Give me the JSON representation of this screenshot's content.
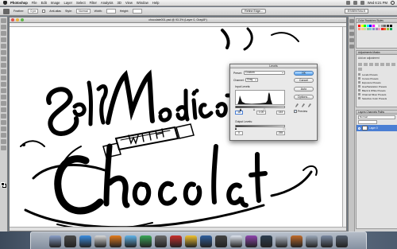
{
  "menubar": {
    "items": [
      "Photoshop",
      "File",
      "Edit",
      "Image",
      "Layer",
      "Select",
      "Filter",
      "Analysis",
      "3D",
      "View",
      "Window",
      "Help"
    ],
    "clock": "Wed 6:21 PM"
  },
  "options": {
    "feather_label": "Feather:",
    "feather_value": "0 px",
    "antialias_label": "Anti-alias",
    "style_label": "Style:",
    "style_value": "Normal",
    "width_label": "Width:",
    "height_label": "Height:",
    "refine_label": "Refine Edge...",
    "workspace_label": "ESSENTIALS"
  },
  "document": {
    "title": "chocolate001.psd @ 93.3% (Layer 0, Gray/8*)"
  },
  "levels_dialog": {
    "title": "Levels",
    "preset_label": "Preset:",
    "preset_value": "Custom",
    "channel_label": "Channel:",
    "channel_value": "Gray",
    "input_levels_label": "Input Levels:",
    "input_black": "18",
    "input_gamma": "1.00",
    "input_white": "144",
    "output_levels_label": "Output Levels:",
    "output_black": "0",
    "output_white": "255",
    "ok_label": "OK",
    "cancel_label": "Cancel",
    "auto_label": "Auto",
    "options_label": "Options...",
    "preview_label": "Preview"
  },
  "panels": {
    "color_tabs": "Color  Swatches  Styles",
    "adjustments_tabs": "Adjustments  Masks",
    "adjustments_title": "Add an adjustment",
    "presets": [
      "Levels Presets",
      "Curves Presets",
      "Exposure Presets",
      "Hue/Saturation Presets",
      "Black & White Presets",
      "Channel Mixer Presets",
      "Selective Color Presets"
    ],
    "layers_tabs": "Layers  Channels  Paths",
    "blend_mode": "Normal",
    "layer_name": "Layer 0"
  },
  "swatch_colors": [
    "#ff0000",
    "#ffff00",
    "#00ff00",
    "#00ffff",
    "#0000ff",
    "#ff00ff",
    "#ffffff",
    "#c8c8c8",
    "#969696",
    "#646464",
    "#323232",
    "#000000",
    "#f7977a",
    "#fdc68a",
    "#c4df9b",
    "#82ca9d",
    "#7bcdc8",
    "#8493ca",
    "#a187be",
    "#f49ac2",
    "#ed1c24",
    "#f26522",
    "#8dc63f",
    "#00a651"
  ],
  "dock_colors": [
    "#8aa0c8",
    "#4a4a4a",
    "#3b8de0",
    "#d9d9d9",
    "#e37c1e",
    "#5fb3e8",
    "#3aa757",
    "#6a6a6a",
    "#c9302c",
    "#f1c232",
    "#2f5f9e",
    "#444444",
    "#dfe6f0",
    "#8e44ad",
    "#2c3e50",
    "#b0b8c4",
    "#c06b2b",
    "#9aa7b8",
    "#7b8aa3",
    "#556070"
  ]
}
